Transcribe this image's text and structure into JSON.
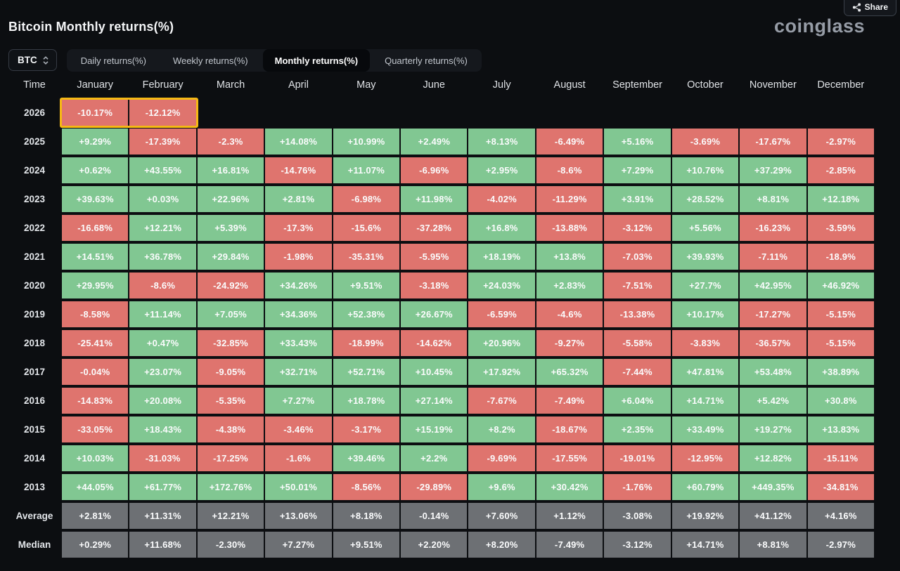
{
  "header": {
    "title": "Bitcoin Monthly returns(%)",
    "brand": "coinglass",
    "share_label": "Share"
  },
  "controls": {
    "symbol": "BTC"
  },
  "tabs": [
    {
      "label": "Daily returns(%)",
      "active": false
    },
    {
      "label": "Weekly returns(%)",
      "active": false
    },
    {
      "label": "Monthly returns(%)",
      "active": true
    },
    {
      "label": "Quarterly returns(%)",
      "active": false
    }
  ],
  "colors": {
    "positive": "#81c792",
    "negative": "#df746e",
    "summary": "#6d7074",
    "highlight": "#f5b914"
  },
  "chart_data": {
    "type": "heatmap",
    "title": "Bitcoin Monthly returns(%)",
    "columns": [
      "Time",
      "January",
      "February",
      "March",
      "April",
      "May",
      "June",
      "July",
      "August",
      "September",
      "October",
      "November",
      "December"
    ],
    "rows": [
      {
        "label": "2026",
        "highlighted": true,
        "values": [
          "-10.17%",
          "-12.12%",
          "",
          "",
          "",
          "",
          "",
          "",
          "",
          "",
          "",
          ""
        ]
      },
      {
        "label": "2025",
        "values": [
          "+9.29%",
          "-17.39%",
          "-2.3%",
          "+14.08%",
          "+10.99%",
          "+2.49%",
          "+8.13%",
          "-6.49%",
          "+5.16%",
          "-3.69%",
          "-17.67%",
          "-2.97%"
        ]
      },
      {
        "label": "2024",
        "values": [
          "+0.62%",
          "+43.55%",
          "+16.81%",
          "-14.76%",
          "+11.07%",
          "-6.96%",
          "+2.95%",
          "-8.6%",
          "+7.29%",
          "+10.76%",
          "+37.29%",
          "-2.85%"
        ]
      },
      {
        "label": "2023",
        "values": [
          "+39.63%",
          "+0.03%",
          "+22.96%",
          "+2.81%",
          "-6.98%",
          "+11.98%",
          "-4.02%",
          "-11.29%",
          "+3.91%",
          "+28.52%",
          "+8.81%",
          "+12.18%"
        ]
      },
      {
        "label": "2022",
        "values": [
          "-16.68%",
          "+12.21%",
          "+5.39%",
          "-17.3%",
          "-15.6%",
          "-37.28%",
          "+16.8%",
          "-13.88%",
          "-3.12%",
          "+5.56%",
          "-16.23%",
          "-3.59%"
        ]
      },
      {
        "label": "2021",
        "values": [
          "+14.51%",
          "+36.78%",
          "+29.84%",
          "-1.98%",
          "-35.31%",
          "-5.95%",
          "+18.19%",
          "+13.8%",
          "-7.03%",
          "+39.93%",
          "-7.11%",
          "-18.9%"
        ]
      },
      {
        "label": "2020",
        "values": [
          "+29.95%",
          "-8.6%",
          "-24.92%",
          "+34.26%",
          "+9.51%",
          "-3.18%",
          "+24.03%",
          "+2.83%",
          "-7.51%",
          "+27.7%",
          "+42.95%",
          "+46.92%"
        ]
      },
      {
        "label": "2019",
        "values": [
          "-8.58%",
          "+11.14%",
          "+7.05%",
          "+34.36%",
          "+52.38%",
          "+26.67%",
          "-6.59%",
          "-4.6%",
          "-13.38%",
          "+10.17%",
          "-17.27%",
          "-5.15%"
        ]
      },
      {
        "label": "2018",
        "values": [
          "-25.41%",
          "+0.47%",
          "-32.85%",
          "+33.43%",
          "-18.99%",
          "-14.62%",
          "+20.96%",
          "-9.27%",
          "-5.58%",
          "-3.83%",
          "-36.57%",
          "-5.15%"
        ]
      },
      {
        "label": "2017",
        "values": [
          "-0.04%",
          "+23.07%",
          "-9.05%",
          "+32.71%",
          "+52.71%",
          "+10.45%",
          "+17.92%",
          "+65.32%",
          "-7.44%",
          "+47.81%",
          "+53.48%",
          "+38.89%"
        ]
      },
      {
        "label": "2016",
        "values": [
          "-14.83%",
          "+20.08%",
          "-5.35%",
          "+7.27%",
          "+18.78%",
          "+27.14%",
          "-7.67%",
          "-7.49%",
          "+6.04%",
          "+14.71%",
          "+5.42%",
          "+30.8%"
        ]
      },
      {
        "label": "2015",
        "values": [
          "-33.05%",
          "+18.43%",
          "-4.38%",
          "-3.46%",
          "-3.17%",
          "+15.19%",
          "+8.2%",
          "-18.67%",
          "+2.35%",
          "+33.49%",
          "+19.27%",
          "+13.83%"
        ]
      },
      {
        "label": "2014",
        "values": [
          "+10.03%",
          "-31.03%",
          "-17.25%",
          "-1.6%",
          "+39.46%",
          "+2.2%",
          "-9.69%",
          "-17.55%",
          "-19.01%",
          "-12.95%",
          "+12.82%",
          "-15.11%"
        ]
      },
      {
        "label": "2013",
        "values": [
          "+44.05%",
          "+61.77%",
          "+172.76%",
          "+50.01%",
          "-8.56%",
          "-29.89%",
          "+9.6%",
          "+30.42%",
          "-1.76%",
          "+60.79%",
          "+449.35%",
          "-34.81%"
        ]
      },
      {
        "label": "Average",
        "summary": true,
        "values": [
          "+2.81%",
          "+11.31%",
          "+12.21%",
          "+13.06%",
          "+8.18%",
          "-0.14%",
          "+7.60%",
          "+1.12%",
          "-3.08%",
          "+19.92%",
          "+41.12%",
          "+4.16%"
        ]
      },
      {
        "label": "Median",
        "summary": true,
        "values": [
          "+0.29%",
          "+11.68%",
          "-2.30%",
          "+7.27%",
          "+9.51%",
          "+2.20%",
          "+8.20%",
          "-7.49%",
          "-3.12%",
          "+14.71%",
          "+8.81%",
          "-2.97%"
        ]
      }
    ]
  }
}
